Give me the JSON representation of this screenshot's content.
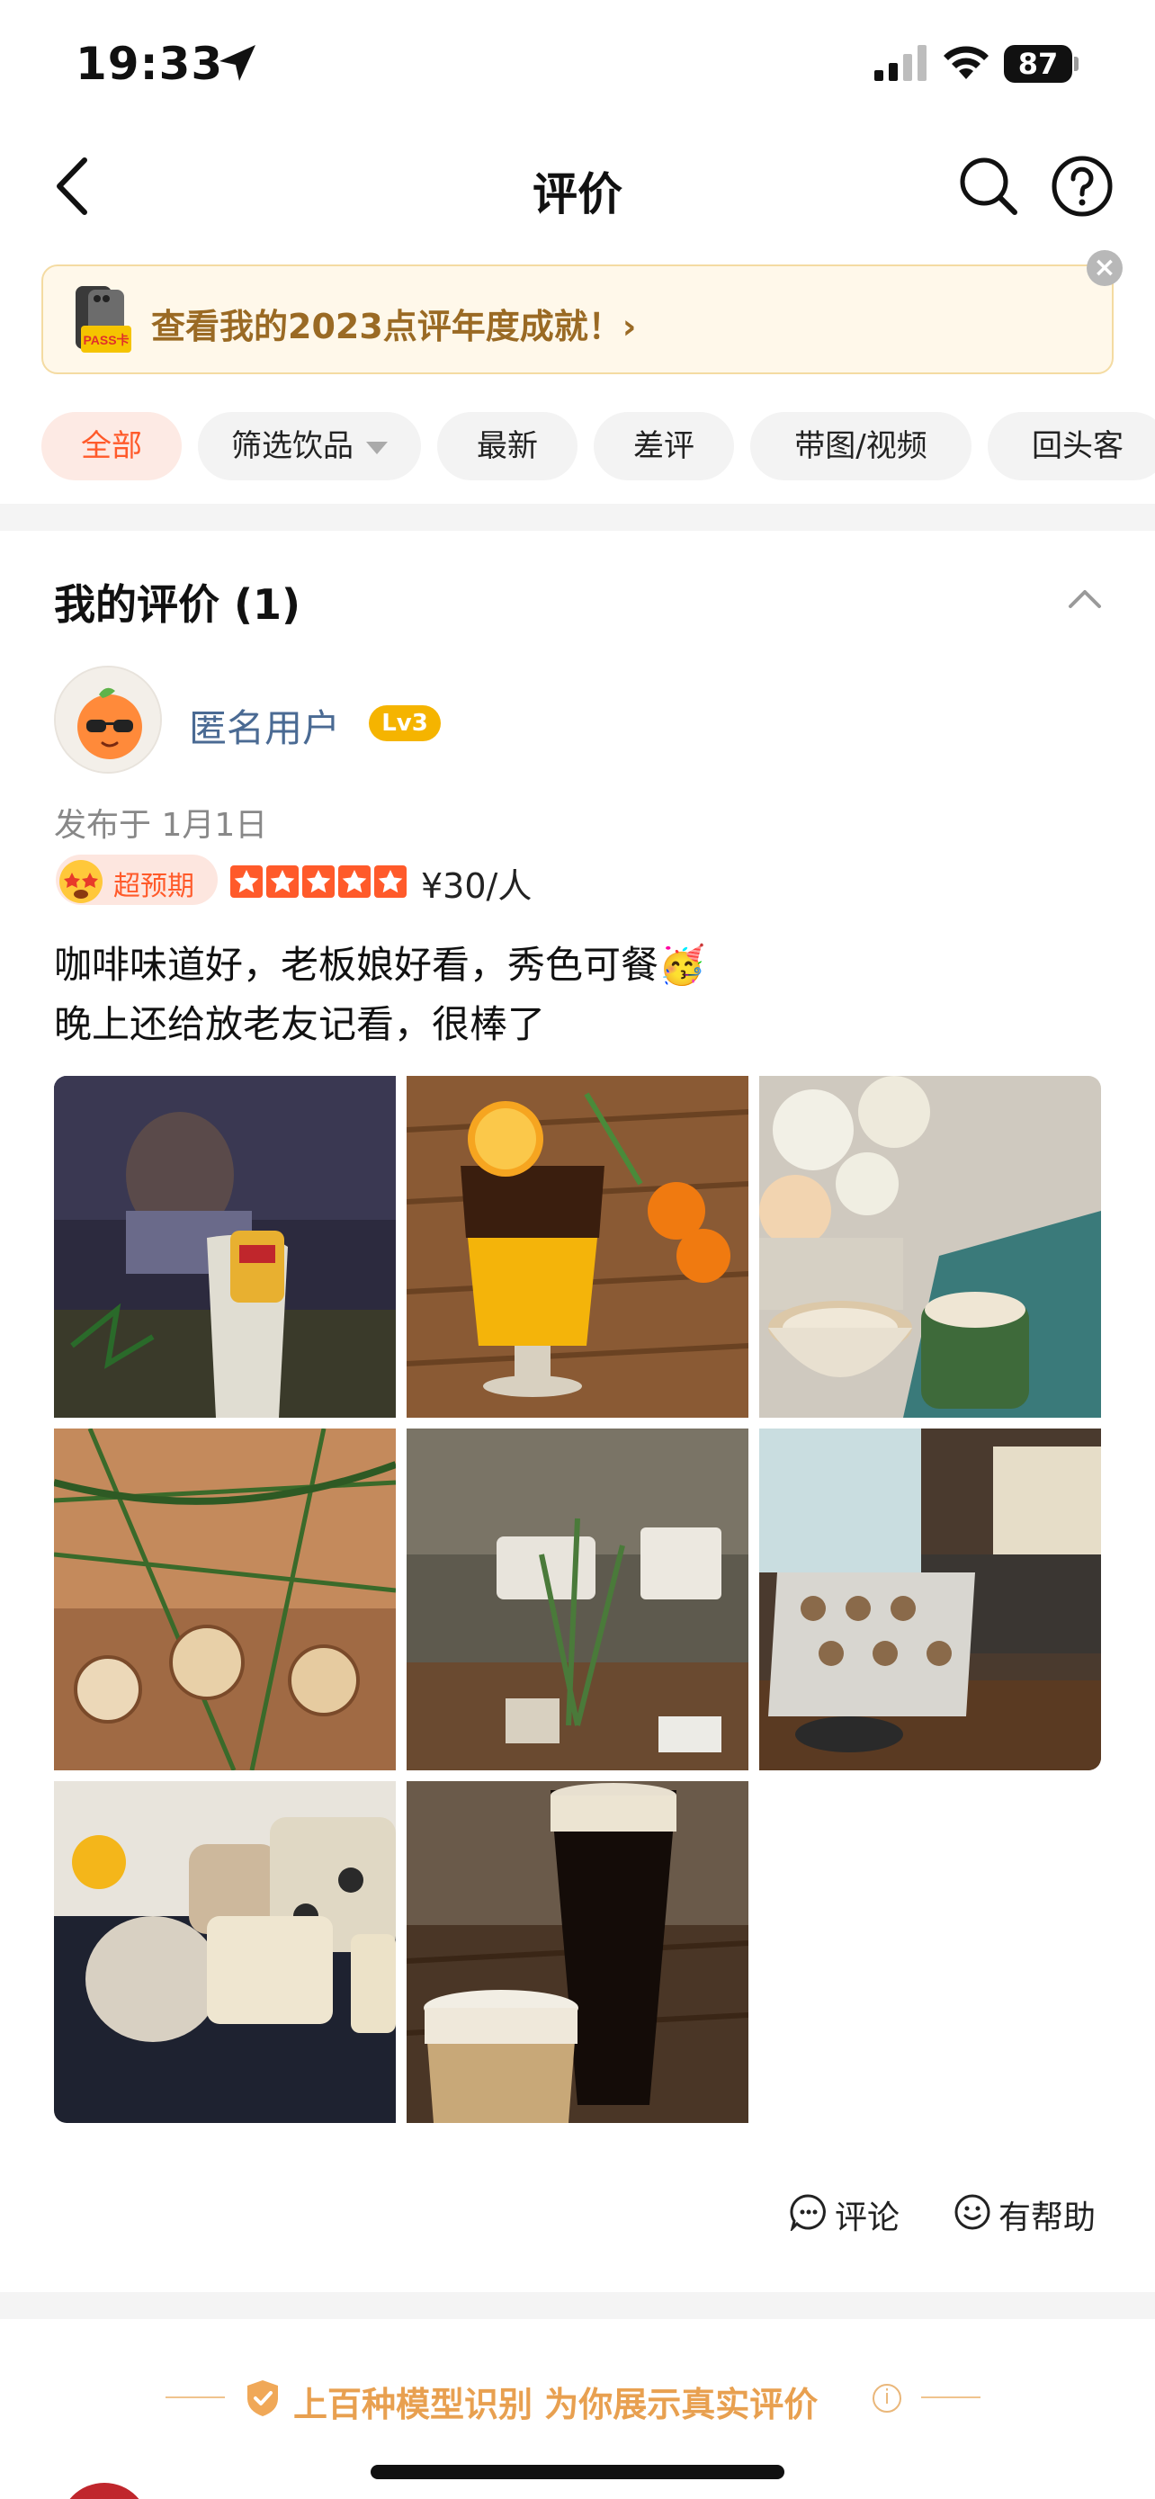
{
  "status_bar": {
    "time": "19:33",
    "battery": "87"
  },
  "nav": {
    "title": "评价"
  },
  "banner": {
    "text": "查看我的2023点评年度成就！›",
    "close": "×"
  },
  "tabs": [
    {
      "label": "全部",
      "active": true
    },
    {
      "label": "筛选饮品",
      "dropdown": true
    },
    {
      "label": "最新"
    },
    {
      "label": "差评"
    },
    {
      "label": "带图/视频"
    },
    {
      "label": "回头客"
    }
  ],
  "my_reviews": {
    "title": "我的评价 (1)",
    "review": {
      "username": "匿名用户",
      "level": "Lv3",
      "date": "发布于 1月1日",
      "expectation": "超预期",
      "rating_stars": 5,
      "price": "¥30/人",
      "text_line1": "咖啡味道好，老板娘好看，秀色可餐🥳",
      "text_line2": "晚上还给放老友记看，很棒了",
      "photo_count": 8,
      "actions": {
        "comment": "评论",
        "helpful": "有帮助"
      }
    }
  },
  "trust_banner": {
    "text": "上百种模型识别 为你展示真实评价",
    "info": "i"
  },
  "colors": {
    "accent": "#ff5a2a",
    "username": "#4a6a93",
    "level": "#f5b400",
    "trust": "#e8a050"
  }
}
